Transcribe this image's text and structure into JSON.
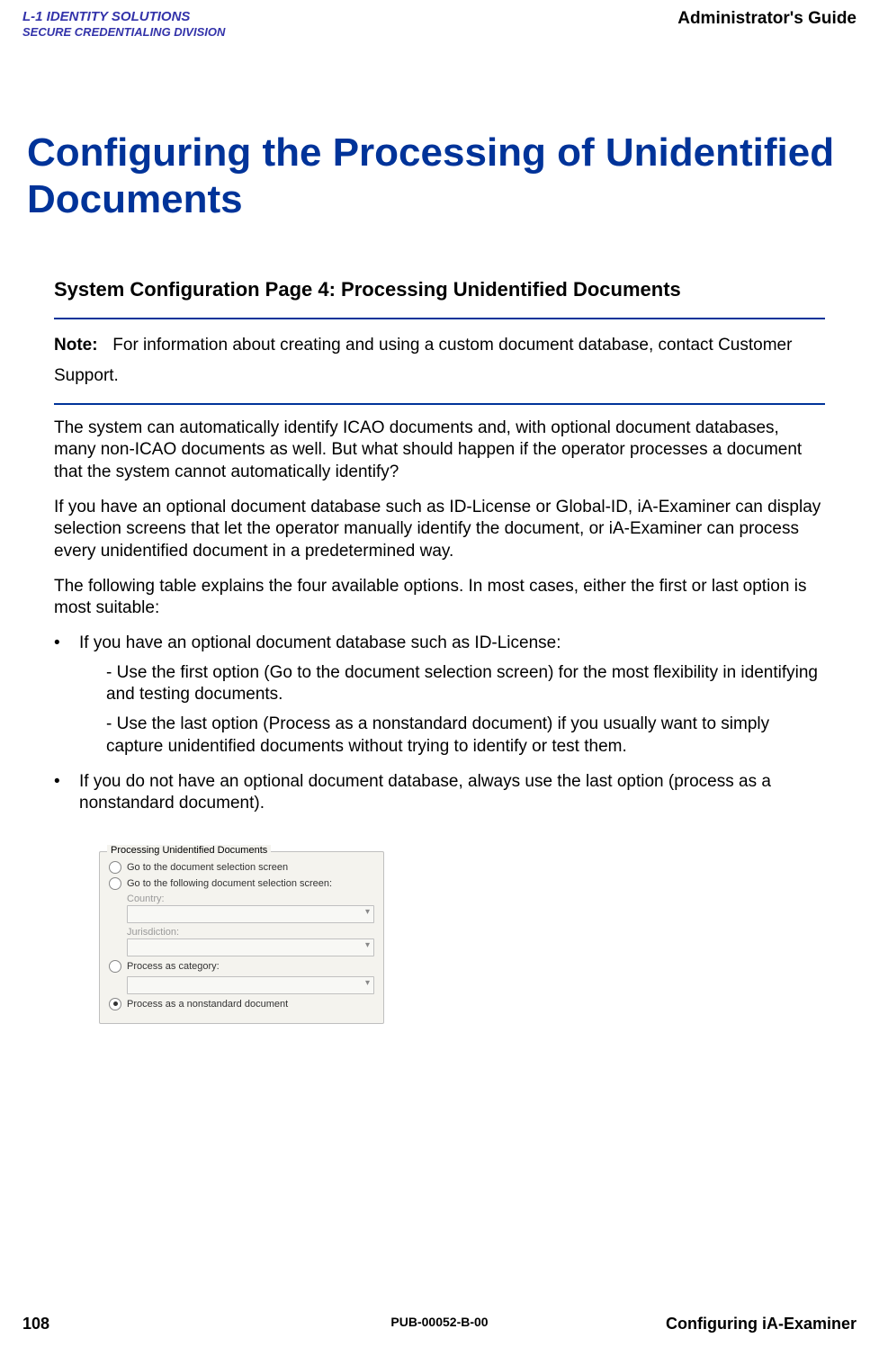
{
  "header": {
    "logo_line1": "L-1 IDENTITY SOLUTIONS",
    "logo_line2": "SECURE CREDENTIALING DIVISION",
    "right": "Administrator's Guide"
  },
  "title": "Configuring the Processing of Unidentified Documents",
  "subtitle": "System Configuration Page 4: Processing Unidentified Documents",
  "note": {
    "label": "Note:",
    "text": "For information about creating and using a custom document database, contact Customer Support."
  },
  "paragraphs": {
    "p1": "The system can automatically identify ICAO documents and, with optional document databases, many non-ICAO documents as well. But what should happen if the operator processes a document that the system cannot automatically identify?",
    "p2": "If you have an optional document database such as ID-License or Global-ID, iA-Examiner can display selection screens that let the operator manually identify the document, or iA-Examiner can process every unidentified document in a predetermined way.",
    "p3": "The following table explains the four available options. In most cases, either the first or last option is most suitable:"
  },
  "bullets": {
    "b1_intro": "If you have an optional document database such as ID-License:",
    "b1_sub1": "- Use the first option (Go to the document selection screen) for the most flexibility in identifying and testing documents.",
    "b1_sub2": "- Use the last option (Process as a nonstandard document) if you usually want to simply capture unidentified documents without trying to identify or test them.",
    "b2": "If you do not have an optional document database, always use the last option (process as a nonstandard document)."
  },
  "panel": {
    "title": "Processing Unidentified Documents",
    "opt1": "Go to the document selection screen",
    "opt2": "Go to the following document selection screen:",
    "country_label": "Country:",
    "jurisdiction_label": "Jurisdiction:",
    "opt3": "Process as category:",
    "opt4": "Process as a nonstandard document"
  },
  "footer": {
    "page": "108",
    "pubid": "PUB-00052-B-00",
    "section": "Configuring iA-Examiner"
  }
}
